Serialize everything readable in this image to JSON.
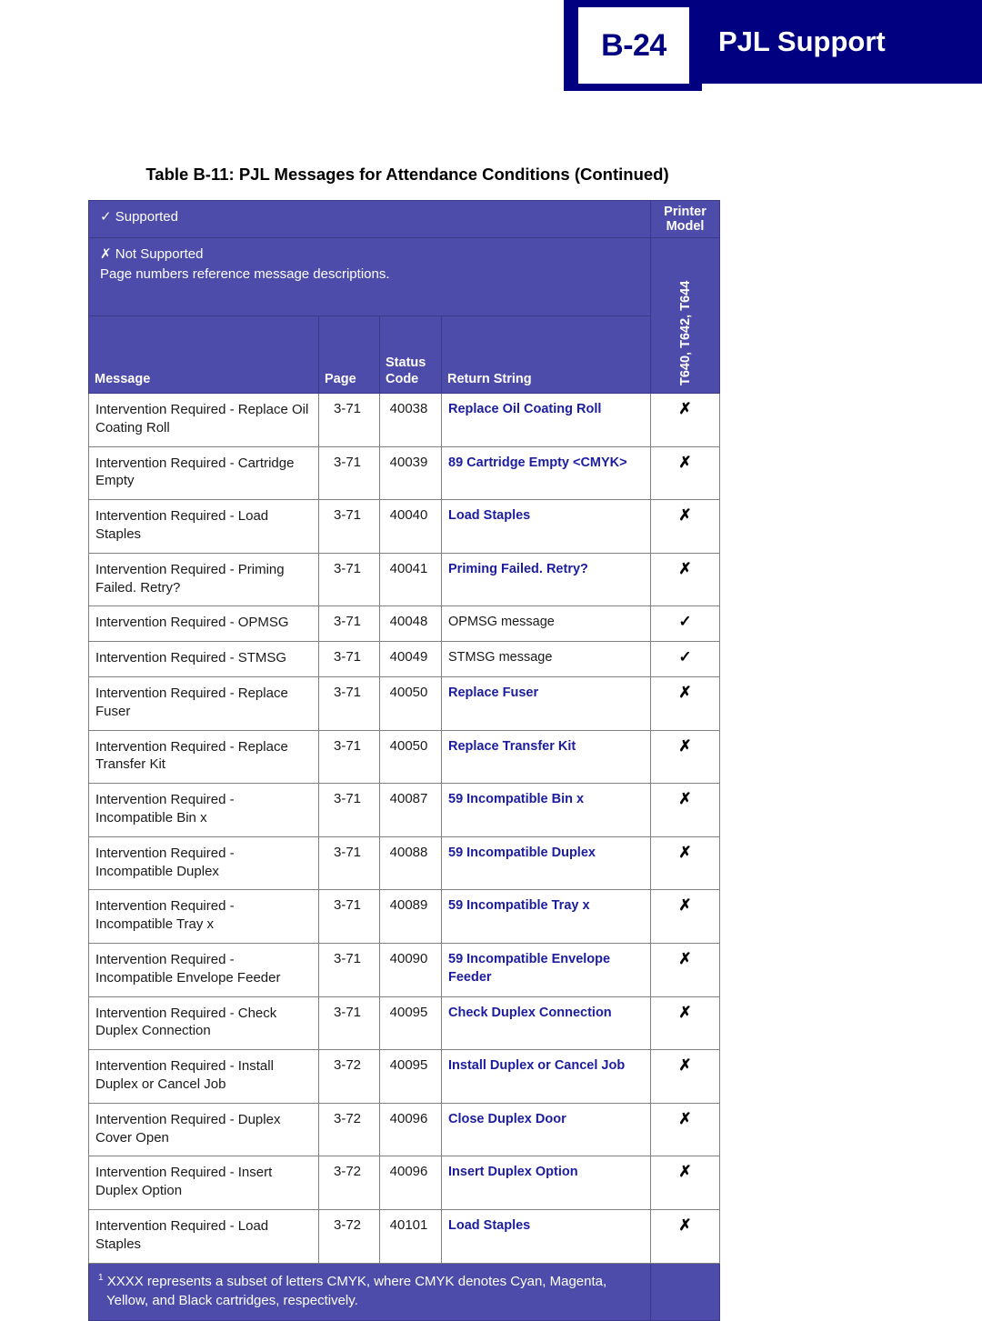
{
  "banner": {
    "page_number": "B-24",
    "section_title": "PJL Support"
  },
  "table": {
    "caption": "Table B-11:  PJL Messages for Attendance Conditions (Continued)",
    "legend": {
      "supported": "✓ Supported",
      "not_supported": "✗ Not Supported",
      "note": "Page numbers reference message descriptions."
    },
    "group_header": "Printer Model",
    "printer_models": "T640, T642, T644",
    "columns": {
      "message": "Message",
      "page": "Page",
      "status_code_line1": "Status",
      "status_code_line2": "Code",
      "return_string": "Return String"
    },
    "rows": [
      {
        "message": "Intervention Required - Replace Oil Coating Roll",
        "page": "3-71",
        "code": "40038",
        "return_string": "Replace Oil Coating Roll",
        "literal": true,
        "support": "✗"
      },
      {
        "message": "Intervention Required - Cartridge Empty",
        "page": "3-71",
        "code": "40039",
        "return_string": "89 Cartridge Empty <CMYK>",
        "literal": true,
        "support": "✗"
      },
      {
        "message": "Intervention Required - Load Staples",
        "page": "3-71",
        "code": "40040",
        "return_string": "Load Staples",
        "literal": true,
        "support": "✗"
      },
      {
        "message": "Intervention Required - Priming Failed. Retry?",
        "page": "3-71",
        "code": "40041",
        "return_string": "Priming Failed. Retry?",
        "literal": true,
        "support": "✗"
      },
      {
        "message": "Intervention Required - OPMSG",
        "page": "3-71",
        "code": "40048",
        "return_string": "OPMSG message",
        "literal": false,
        "support": "✓"
      },
      {
        "message": "Intervention Required - STMSG",
        "page": "3-71",
        "code": "40049",
        "return_string": "STMSG message",
        "literal": false,
        "support": "✓"
      },
      {
        "message": "Intervention Required - Replace Fuser",
        "page": "3-71",
        "code": "40050",
        "return_string": "Replace Fuser",
        "literal": true,
        "support": "✗"
      },
      {
        "message": "Intervention Required - Replace Transfer Kit",
        "page": "3-71",
        "code": "40050",
        "return_string": "Replace Transfer Kit",
        "literal": true,
        "support": "✗"
      },
      {
        "message": "Intervention Required - Incompatible Bin x",
        "page": "3-71",
        "code": "40087",
        "return_string": "59 Incompatible Bin x",
        "literal": true,
        "support": "✗"
      },
      {
        "message": "Intervention Required - Incompatible Duplex",
        "page": "3-71",
        "code": "40088",
        "return_string": "59 Incompatible Duplex",
        "literal": true,
        "support": "✗"
      },
      {
        "message": "Intervention Required - Incompatible Tray x",
        "page": "3-71",
        "code": "40089",
        "return_string": "59 Incompatible Tray x",
        "literal": true,
        "support": "✗"
      },
      {
        "message": "Intervention Required - Incompatible Envelope Feeder",
        "page": "3-71",
        "code": "40090",
        "return_string": "59 Incompatible Envelope Feeder",
        "literal": true,
        "support": "✗"
      },
      {
        "message": "Intervention Required - Check Duplex Connection",
        "page": "3-71",
        "code": "40095",
        "return_string": "Check Duplex Connection",
        "literal": true,
        "support": "✗"
      },
      {
        "message": "Intervention Required - Install Duplex or Cancel Job",
        "page": "3-72",
        "code": "40095",
        "return_string": "Install Duplex or Cancel Job",
        "literal": true,
        "support": "✗"
      },
      {
        "message": "Intervention Required - Duplex Cover Open",
        "page": "3-72",
        "code": "40096",
        "return_string": "Close Duplex Door",
        "literal": true,
        "support": "✗"
      },
      {
        "message": "Intervention Required - Insert Duplex Option",
        "page": "3-72",
        "code": "40096",
        "return_string": "Insert Duplex Option",
        "literal": true,
        "support": "✗"
      },
      {
        "message": "Intervention Required - Load Staples",
        "page": "3-72",
        "code": "40101",
        "return_string": "Load Staples",
        "literal": true,
        "support": "✗"
      }
    ],
    "footnote": {
      "marker": "1",
      "line1": "XXXX represents a subset of letters CMYK, where CMYK denotes Cyan, Magenta,",
      "line2": "Yellow, and Black cartridges, respectively."
    }
  },
  "colors": {
    "banner_navy": "#000080",
    "header_purple": "#4d4cab",
    "literal_blue": "#1c1c9e",
    "grid_gray": "#808080"
  }
}
